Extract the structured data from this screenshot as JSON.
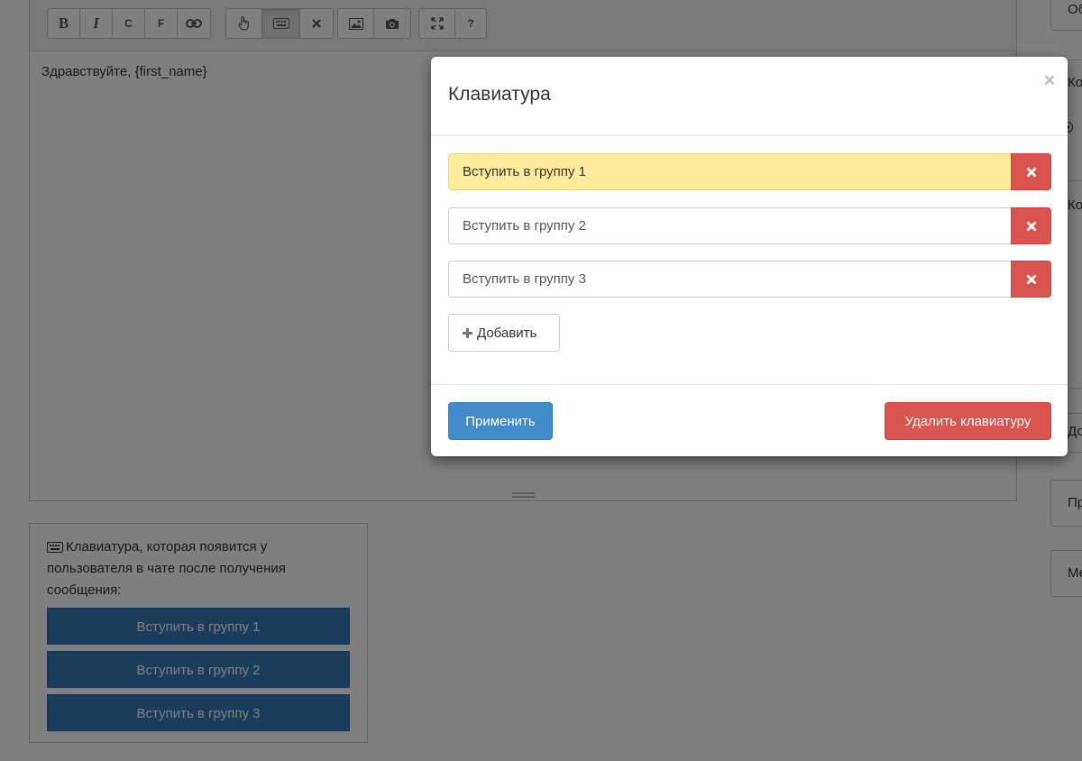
{
  "editor": {
    "toolbar": {
      "bold_glyph": "B",
      "italic_glyph": "I",
      "c_label": "C",
      "f_label": "F",
      "help_label": "?"
    },
    "content": "Здравствуйте, {first_name}"
  },
  "preview": {
    "caption": "Клавиатура, которая появится у пользователя в чате после получения сообщения:",
    "buttons": [
      "Вступить в группу 1",
      "Вступить в группу 2",
      "Вступить в группу 3"
    ],
    "button_color": "#337ab7"
  },
  "sidebar": {
    "btn1": "Об",
    "panel_line1": "Ко",
    "panel_line2": "Ко",
    "btn2": "До",
    "btn3": "Пр",
    "btn4": "Ме"
  },
  "modal": {
    "title": "Клавиатура",
    "close": "×",
    "rows": [
      "Вступить в группу 1",
      "Вступить в группу 2",
      "Вступить в группу 3"
    ],
    "add_label": "Добавить",
    "apply_label": "Применить",
    "remove_label": "Удалить клавиатуру",
    "colors": {
      "highlight": "#ffeb9c",
      "danger": "#d9534f",
      "primary": "#428bca"
    }
  }
}
